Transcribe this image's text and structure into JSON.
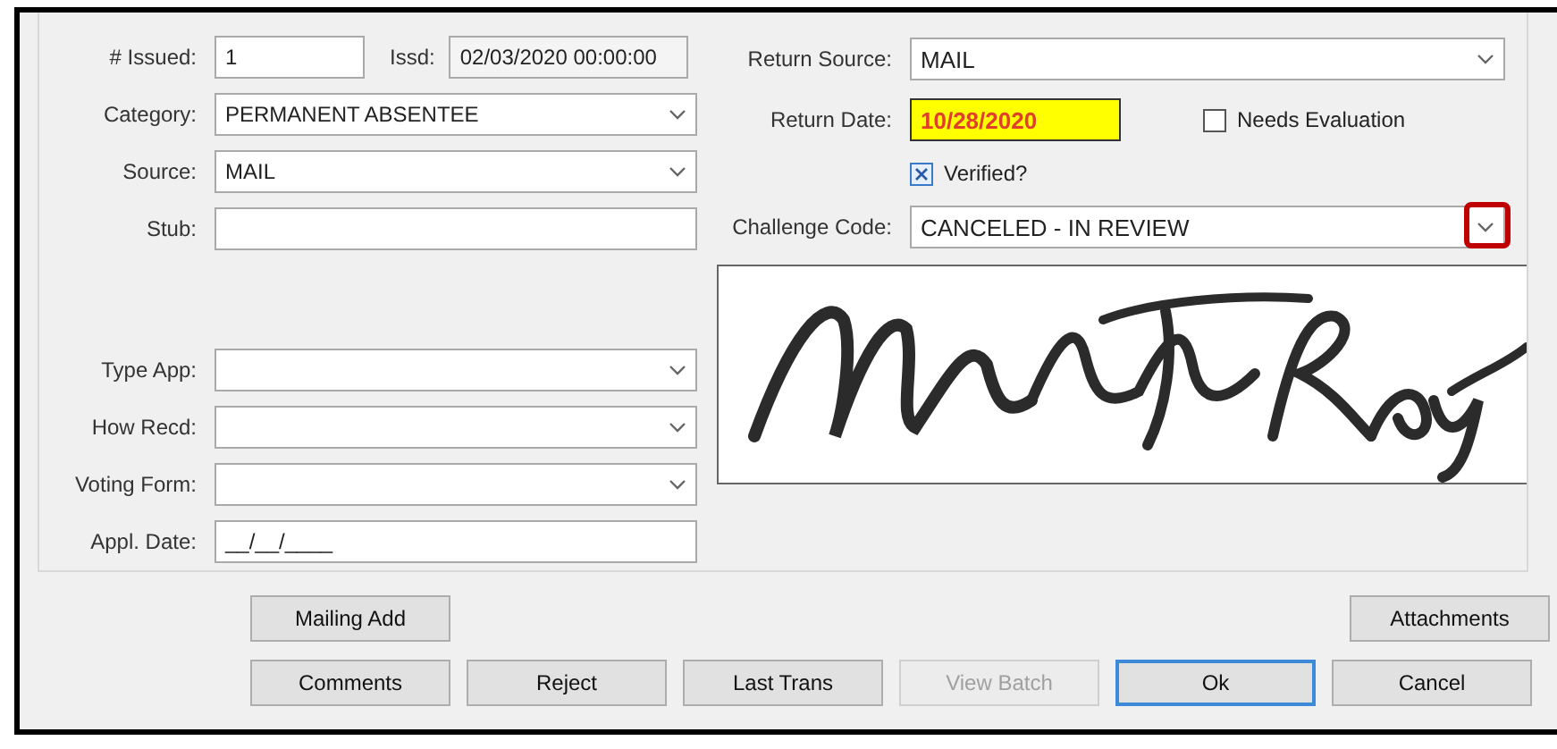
{
  "issued": {
    "label": "# Issued:",
    "value": "1"
  },
  "issued_date": {
    "label": "Issd:",
    "value": "02/03/2020 00:00:00"
  },
  "left_fields": [
    {
      "kind": "dropdown",
      "label": "Category:",
      "value": "PERMANENT ABSENTEE"
    },
    {
      "kind": "dropdown",
      "label": "Source:",
      "value": "MAIL"
    },
    {
      "kind": "text",
      "label": "Stub:"
    }
  ],
  "return_source": {
    "label": "Return Source:",
    "value": "MAIL"
  },
  "return_date": {
    "label": "Return Date:",
    "value": "10/28/2020",
    "highlighted": true
  },
  "needs_evaluation": {
    "label": "Needs Evaluation",
    "checked": false
  },
  "verified": {
    "label": "Verified?",
    "checked": true
  },
  "challenge_code": {
    "label": "Challenge Code:",
    "value": "CANCELED - IN REVIEW",
    "callout": true
  },
  "lower_fields": [
    {
      "kind": "dropdown",
      "label": "Type App:"
    },
    {
      "kind": "dropdown",
      "label": "How Recd:"
    },
    {
      "kind": "dropdown",
      "label": "Voting Form:"
    },
    {
      "kind": "text",
      "label": "Appl. Date:",
      "value": "__/__/____"
    }
  ],
  "buttons_top": [
    {
      "label": "Mailing Add",
      "disabled": false,
      "default": false
    },
    {
      "label": "Attachments",
      "disabled": false,
      "default": false
    }
  ],
  "buttons_bottom": [
    {
      "label": "Comments",
      "disabled": false,
      "default": false
    },
    {
      "label": "Reject",
      "disabled": false,
      "default": false
    },
    {
      "label": "Last Trans",
      "disabled": false,
      "default": false
    },
    {
      "label": "View Batch",
      "disabled": true,
      "default": false
    },
    {
      "label": "Ok",
      "disabled": false,
      "default": true
    },
    {
      "label": "Cancel",
      "disabled": false,
      "default": false
    }
  ]
}
